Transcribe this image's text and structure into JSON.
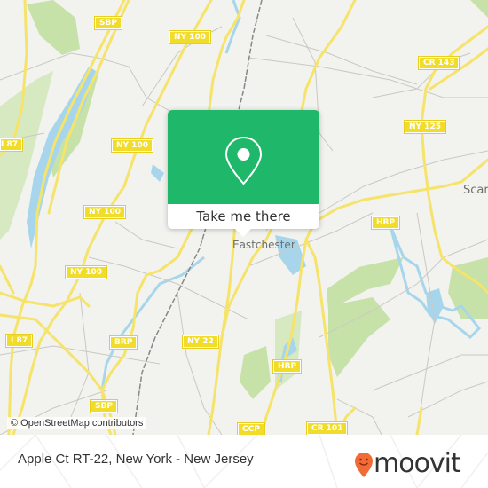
{
  "map": {
    "road_labels": [
      "SBP",
      "NY 100",
      "NY 100",
      "NY 100",
      "NY 100",
      "I 87",
      "BRP",
      "NY 22",
      "SBP",
      "HRP",
      "HRP",
      "CCP",
      "CR 101",
      "CR 143",
      "NY 125",
      "I 87"
    ],
    "place_labels": [
      "Eastchester",
      "Scar"
    ],
    "attribution": "© OpenStreetMap contributors",
    "colors": {
      "land": "#f2f2ee",
      "water": "#a7d6ec",
      "park": "#c7e2a9",
      "road": "#f6e36a",
      "minor_road": "#c9c9c4"
    }
  },
  "popup": {
    "icon": "map-pin-icon",
    "button_label": "Take me there",
    "color": "#1fb86a"
  },
  "footer": {
    "title": "Apple Ct RT-22, New York - New Jersey",
    "logo_text": "moovit",
    "logo_color": "#f26a35"
  }
}
